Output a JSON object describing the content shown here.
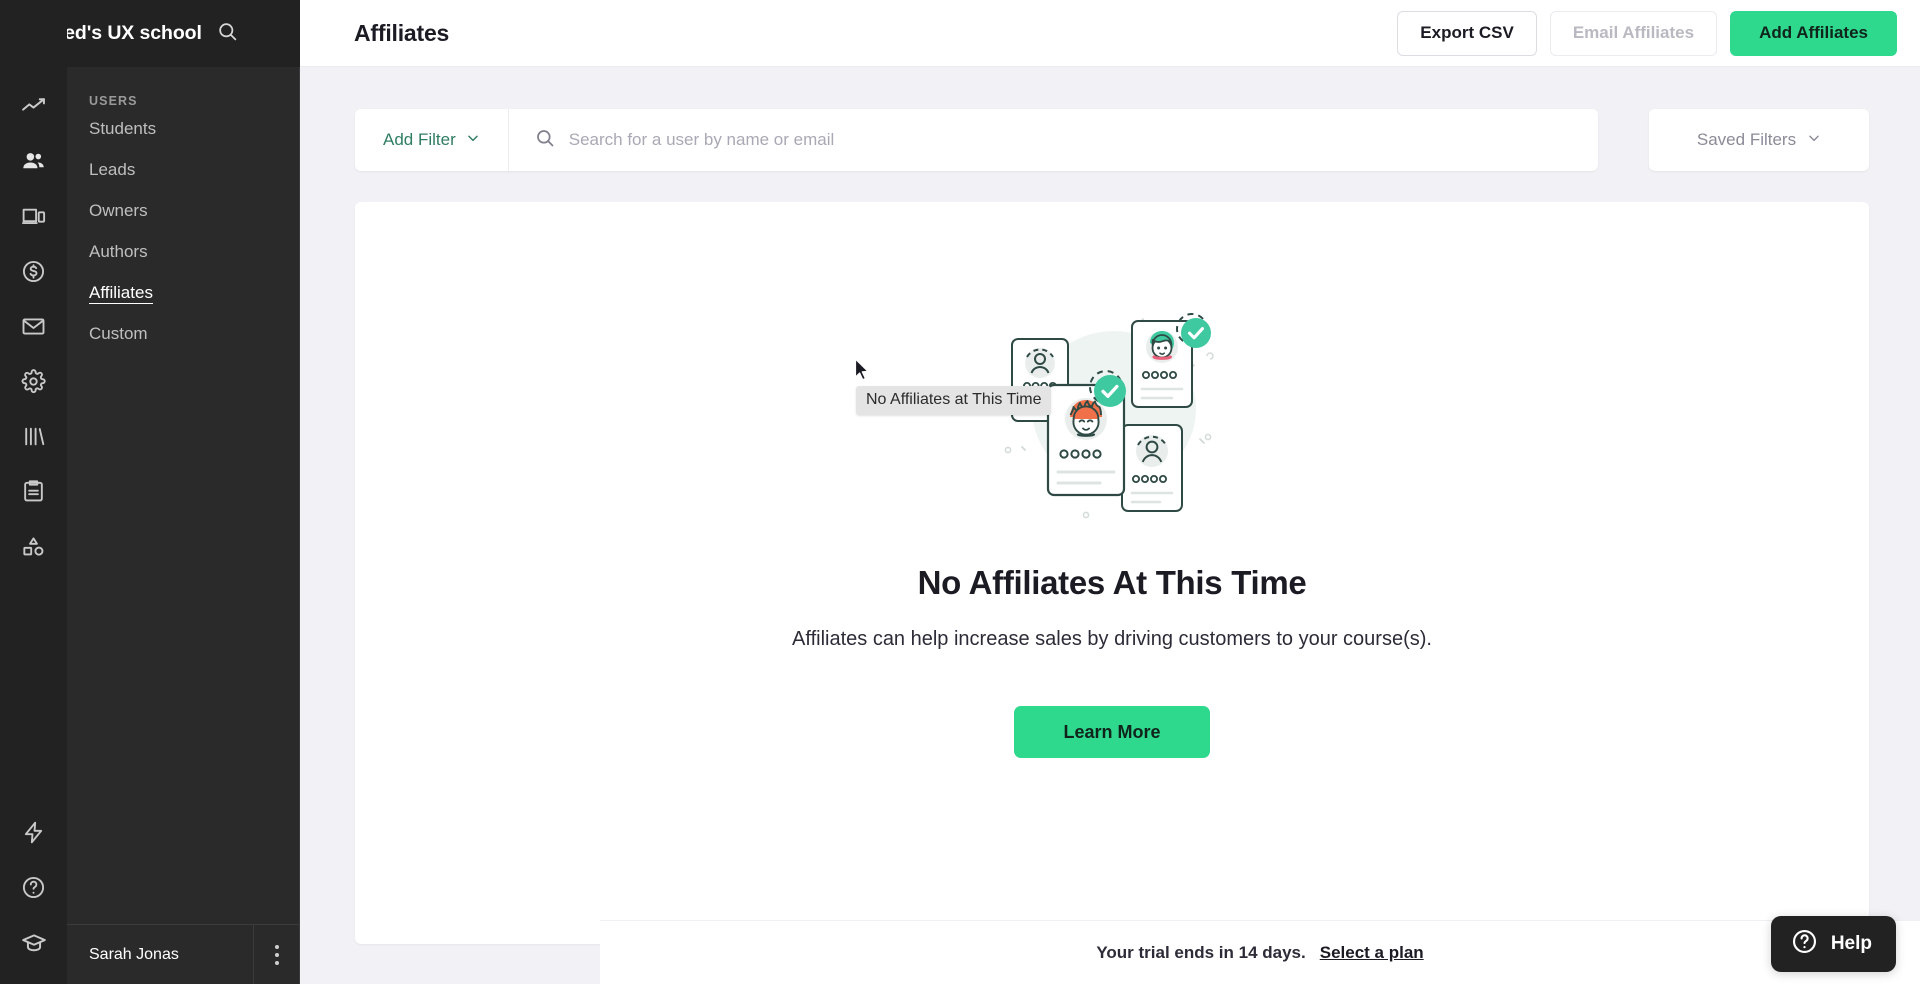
{
  "brand": {
    "title": "UI Feed's UX school",
    "search_icon": "search-icon"
  },
  "rail": {
    "items": [
      {
        "icon": "analytics-trending-icon",
        "name": "rail-item-analytics"
      },
      {
        "icon": "users-icon",
        "name": "rail-item-users"
      },
      {
        "icon": "devices-icon",
        "name": "rail-item-products"
      },
      {
        "icon": "dollar-circle-icon",
        "name": "rail-item-sales"
      },
      {
        "icon": "mail-icon",
        "name": "rail-item-marketing"
      },
      {
        "icon": "gear-icon",
        "name": "rail-item-settings"
      },
      {
        "icon": "books-icon",
        "name": "rail-item-library"
      },
      {
        "icon": "clipboard-icon",
        "name": "rail-item-forms"
      },
      {
        "icon": "shapes-icon",
        "name": "rail-item-site"
      }
    ],
    "bottom": [
      {
        "icon": "lightning-bolt-icon",
        "name": "rail-item-automations"
      },
      {
        "icon": "question-circle-icon",
        "name": "rail-item-help"
      },
      {
        "icon": "graduation-cap-icon",
        "name": "rail-item-academy"
      }
    ]
  },
  "sidebar": {
    "section_label": "USERS",
    "items": [
      {
        "label": "Students",
        "active": false
      },
      {
        "label": "Leads",
        "active": false
      },
      {
        "label": "Owners",
        "active": false
      },
      {
        "label": "Authors",
        "active": false
      },
      {
        "label": "Affiliates",
        "active": true
      },
      {
        "label": "Custom",
        "active": false
      }
    ],
    "user": {
      "name": "Sarah Jonas",
      "menu_icon": "kebab-menu-icon"
    }
  },
  "header": {
    "title": "Affiliates",
    "buttons": {
      "export_csv": "Export CSV",
      "email_affiliates": "Email Affiliates",
      "add_affiliates": "Add Affiliates"
    }
  },
  "filters": {
    "add_filter_label": "Add Filter",
    "search_placeholder": "Search for a user by name or email",
    "search_value": "",
    "saved_filters_label": "Saved Filters"
  },
  "empty_state": {
    "title": "No Affiliates At This Time",
    "subtitle": "Affiliates can help increase sales by driving customers to your course(s).",
    "cta_label": "Learn More",
    "illustration": "affiliate-profile-cards-illustration"
  },
  "tooltip": {
    "text": "No Affiliates at This Time"
  },
  "trial": {
    "message": "Your trial ends in 14 days.",
    "link_label": "Select a plan"
  },
  "help_widget": {
    "label": "Help",
    "icon": "question-circle-icon"
  },
  "colors": {
    "accent_green": "#2ED98E",
    "add_filter_green": "#2F7D61",
    "rail_dark": "#222222",
    "subnav_dark": "#2A2A2A",
    "page_bg": "#F2F2F6",
    "text_dark": "#1B1B24"
  }
}
